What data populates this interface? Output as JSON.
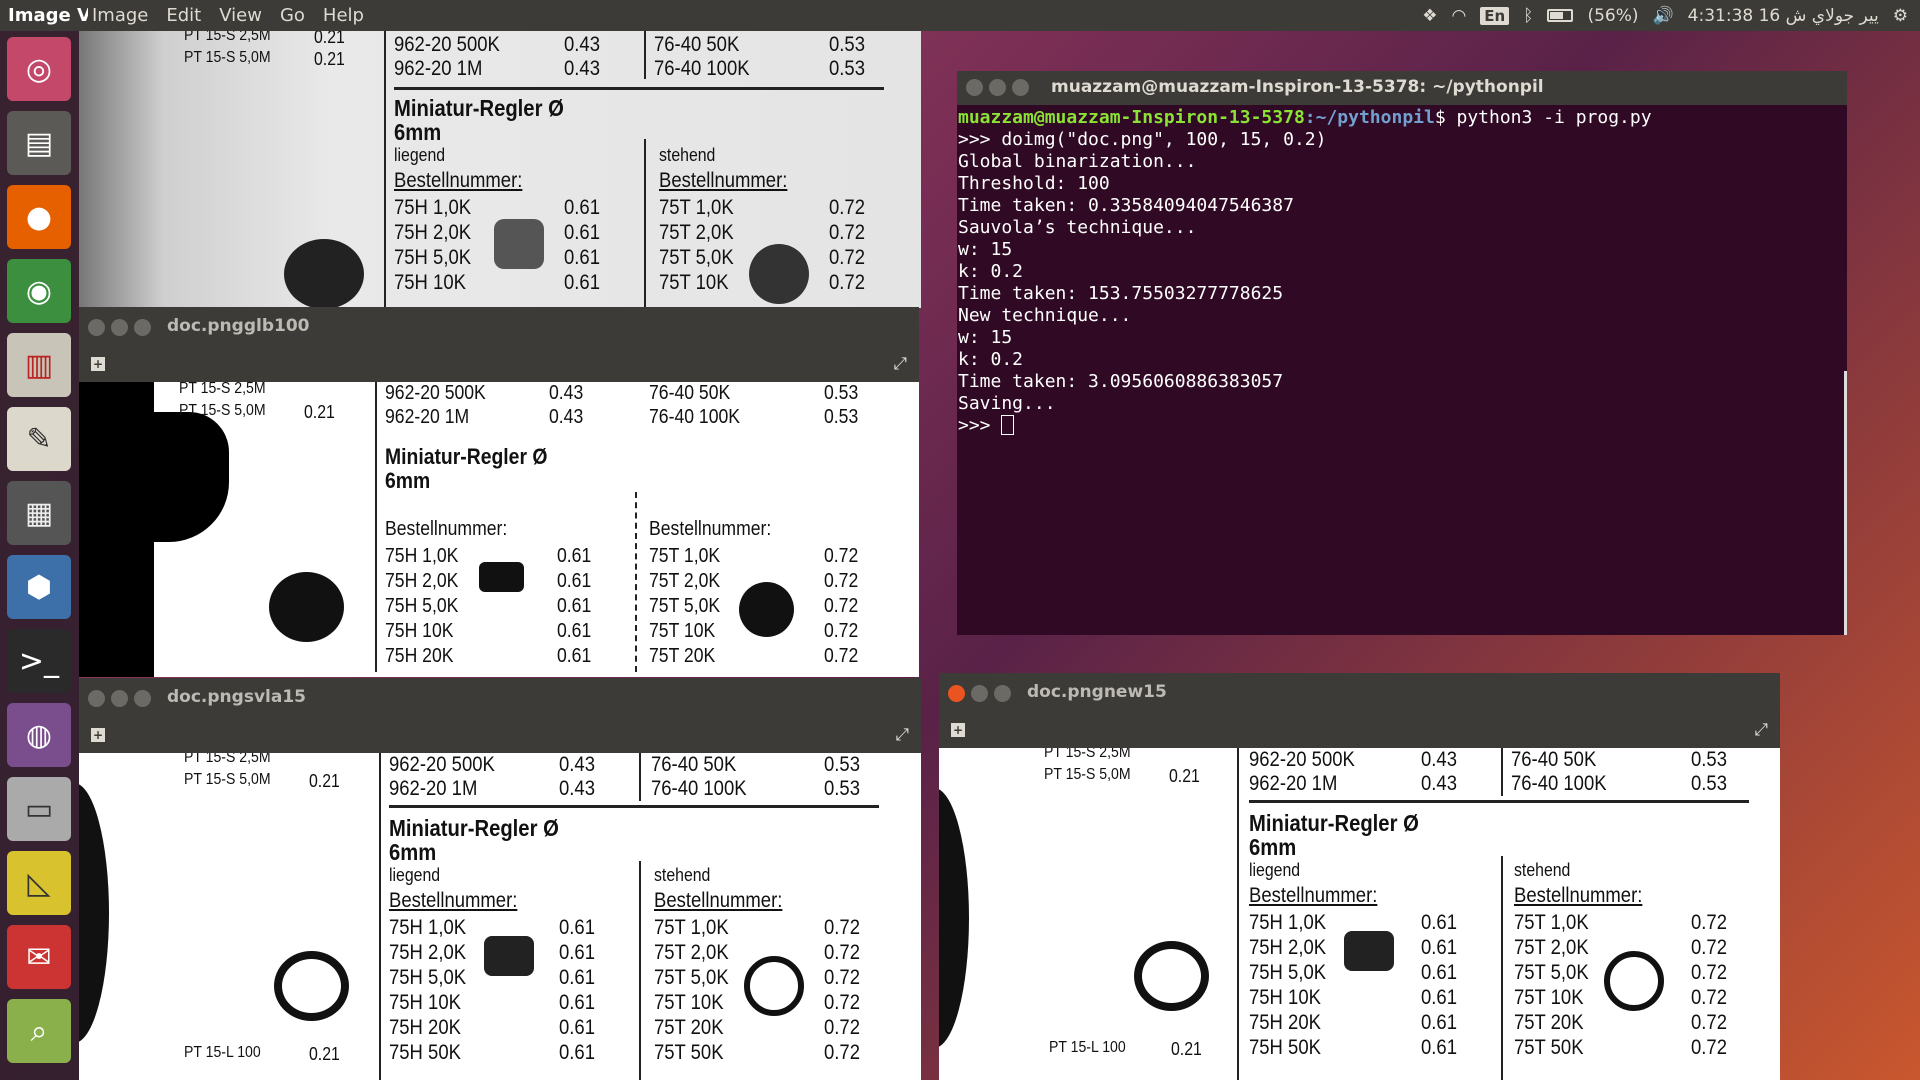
{
  "topbar": {
    "app": "Image V",
    "menus": [
      "Image",
      "Edit",
      "View",
      "Go",
      "Help"
    ],
    "lang": "En",
    "battery": "(56%)",
    "clock": "4:31:38 16 يير جولاي ش"
  },
  "launcher": [
    "ubuntu",
    "files",
    "firefox",
    "chrome",
    "reader",
    "editor",
    "calculator",
    "virtualbox",
    "terminal",
    "webcam",
    "disk",
    "ruler",
    "mail",
    "monitor",
    "viewer"
  ],
  "doc": {
    "a1": "PT 15-S 2,5M",
    "a2": "PT 15-S 5,0M",
    "a1v": "0.21",
    "a2v": "0.21",
    "r1": "962-20 500K",
    "r1v": "0.43",
    "r2": "962-20 1M",
    "r2v": "0.43",
    "s1": "76-40 50K",
    "s1v": "0.53",
    "s2": "76-40 100K",
    "s2v": "0.53",
    "heading": "Miniatur-Regler Ø",
    "heading2": "6mm",
    "liegend": "liegend",
    "stehend": "stehend",
    "best": "Bestellnummer:",
    "left": [
      "75H 1,0K",
      "75H 2,0K",
      "75H 5,0K",
      "75H 10K",
      "75H 20K",
      "75H 50K"
    ],
    "lv": "0.61",
    "right": [
      "75T 1,0K",
      "75T 2,0K",
      "75T 5,0K",
      "75T 10K",
      "75T 20K",
      "75T 50K"
    ],
    "rv": "0.72",
    "pt1": "PT 15-L 100",
    "pt1v": "0.21"
  },
  "windows": {
    "w2": "doc.pngglb100",
    "w3": "doc.pngsvla15",
    "w4": "doc.pngnew15"
  },
  "terminal": {
    "title": "muazzam@muazzam-Inspiron-13-5378: ~/pythonpil",
    "user": "muazzam@muazzam-Inspiron-13-5378",
    "path": ":~/pythonpil",
    "cmd": "$ python3 -i prog.py",
    "lines": [
      ">>> doimg(\"doc.png\", 100, 15, 0.2)",
      "Global binarization...",
      "Threshold: 100",
      "Time taken: 0.33584094047546387",
      "Sauvola’s technique...",
      "w: 15",
      "k: 0.2",
      "Time taken: 153.75503277778625",
      "New technique...",
      "w: 15",
      "k: 0.2",
      "Time taken: 3.0956060886383057",
      "Saving..."
    ],
    "prompt": ">>> "
  }
}
